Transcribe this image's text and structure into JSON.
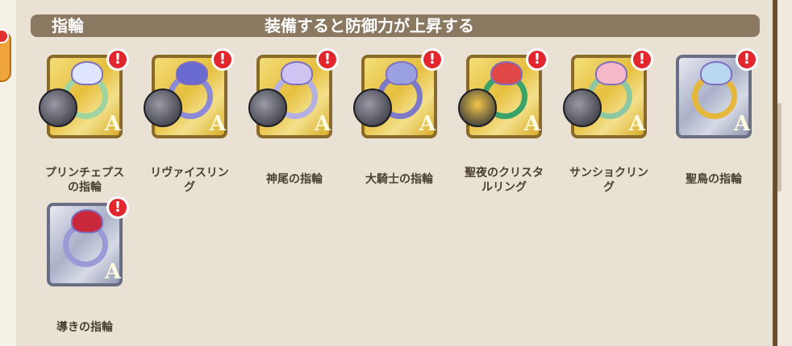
{
  "header": {
    "title": "指輪",
    "description": "装備すると防御力が上昇する"
  },
  "items": [
    {
      "name": "プリンチェプスの指輪",
      "line1": "プリンチェプス",
      "line2": "の指輪",
      "frame": "gold",
      "ring_color": "#9fd3a0",
      "gem_color": "#dfe6ff",
      "material": true,
      "alert": "!"
    },
    {
      "name": "リヴァイスリング",
      "line1": "リヴァイスリン",
      "line2": "グ",
      "frame": "gold",
      "ring_color": "#8a8ad6",
      "gem_color": "#6a6ad0",
      "material": true,
      "alert": "!"
    },
    {
      "name": "神尾の指輪",
      "line1": "神尾の指輪",
      "line2": "",
      "frame": "gold",
      "ring_color": "#b5b0e4",
      "gem_color": "#cfc3f2",
      "material": true,
      "alert": "!"
    },
    {
      "name": "大騎士の指輪",
      "line1": "大騎士の指輪",
      "line2": "",
      "frame": "gold",
      "ring_color": "#7c7ac8",
      "gem_color": "#9aa0e0",
      "material": true,
      "alert": "!"
    },
    {
      "name": "聖夜のクリスタルリング",
      "line1": "聖夜のクリスタ",
      "line2": "ルリング",
      "frame": "gold",
      "ring_color": "#3aa36a",
      "gem_color": "#e04848",
      "material": true,
      "alert": "!"
    },
    {
      "name": "サンショクリング",
      "line1": "サンショクリン",
      "line2": "グ",
      "frame": "gold",
      "ring_color": "#8ec8a0",
      "gem_color": "#f4b8c8",
      "material": true,
      "alert": "!"
    },
    {
      "name": "聖鳥の指輪",
      "line1": "聖鳥の指輪",
      "line2": "",
      "frame": "silver",
      "ring_color": "#e5b73a",
      "gem_color": "#b8d8f2",
      "material": false,
      "alert": "!"
    },
    {
      "name": "導きの指輪",
      "line1": "導きの指輪",
      "line2": "",
      "frame": "silver",
      "ring_color": "#9a9ad6",
      "gem_color": "#c8283a",
      "material": false,
      "alert": "!"
    }
  ]
}
